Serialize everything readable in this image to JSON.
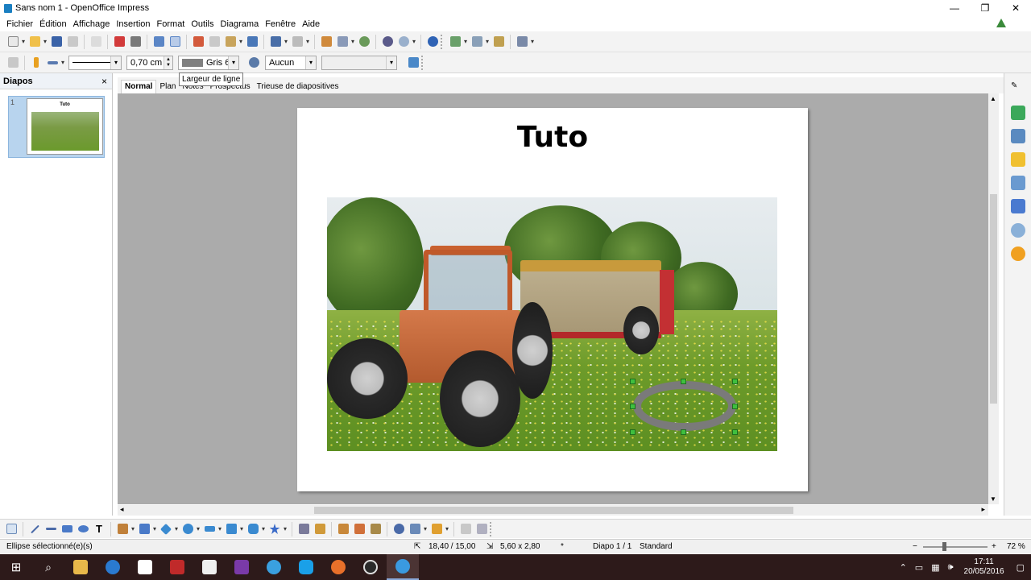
{
  "window": {
    "title": "Sans nom 1 - OpenOffice Impress",
    "minimize": "—",
    "maximize": "❐",
    "close": "✕"
  },
  "menu": [
    "Fichier",
    "Édition",
    "Affichage",
    "Insertion",
    "Format",
    "Outils",
    "Diagrama",
    "Fenêtre",
    "Aide"
  ],
  "line_toolbar": {
    "line_width": "0,70 cm",
    "line_color": "Gris 6",
    "area_style": "Aucun",
    "tooltip": "Largeur de ligne"
  },
  "slides_pane": {
    "title": "Diapos",
    "close": "×",
    "slide_number": "1",
    "thumb_title": "Tuto"
  },
  "view_tabs": [
    "Normal",
    "Plan",
    "Notes",
    "Prospectus",
    "Trieuse de diapositives"
  ],
  "slide": {
    "title": "Tuto"
  },
  "status": {
    "selection": "Ellipse sélectionné(e)(s)",
    "position": "18,40 / 15,00",
    "size": "5,60 x 2,80",
    "modified": "*",
    "slide": "Diapo 1 / 1",
    "layout": "Standard",
    "zoom": "72 %",
    "zoom_minus": "−",
    "zoom_plus": "+"
  },
  "taskbar": {
    "time": "17:11",
    "date": "20/05/2016"
  },
  "colors": {
    "selection_handle": "#3fbf3f",
    "ellipse_line": "#7a7a7a",
    "taskbar": "#2d1a1a"
  }
}
